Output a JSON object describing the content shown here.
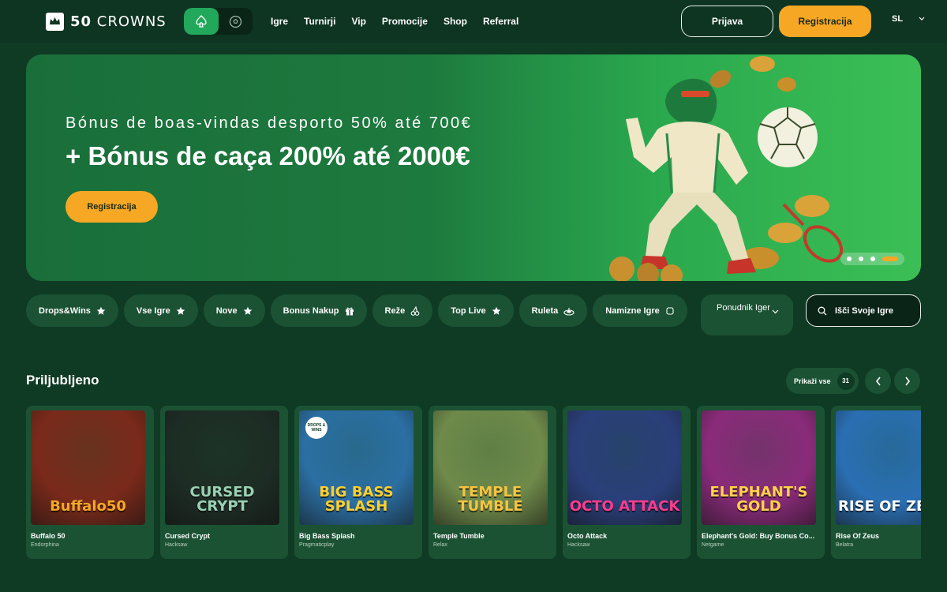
{
  "header": {
    "logo_text_bold": "50",
    "logo_text": "CROWNS",
    "nav": [
      "Igre",
      "Turnirji",
      "Vip",
      "Promocije",
      "Shop",
      "Referral"
    ],
    "login_label": "Prijava",
    "register_label": "Registracija",
    "language": "SL"
  },
  "banner": {
    "subtitle": "Bónus de boas-vindas desporto 50% até 700€",
    "title": "+ Bónus de caça 200% até 2000€",
    "cta_label": "Registracija",
    "slides": 4,
    "active_slide": 4
  },
  "categories": [
    {
      "label": "Drops&Wins",
      "icon": "star-icon"
    },
    {
      "label": "Vse Igre",
      "icon": "star-icon"
    },
    {
      "label": "Nove",
      "icon": "star-icon"
    },
    {
      "label": "Bonus Nakup",
      "icon": "gift-icon"
    },
    {
      "label": "Reže",
      "icon": "cherries-icon"
    },
    {
      "label": "Top Live",
      "icon": "star-icon"
    },
    {
      "label": "Ruleta",
      "icon": "roulette-icon"
    },
    {
      "label": "Namizne Igre",
      "icon": "chip-icon"
    }
  ],
  "provider_filter": {
    "label": "Ponudnik Iger"
  },
  "search": {
    "placeholder": "Išči Svoje Igre"
  },
  "favorites": {
    "title": "Priljubljeno",
    "show_all_label": "Prikaži vse",
    "count": "31",
    "games": [
      {
        "name": "Buffalo 50",
        "provider": "Endorphina",
        "art": "Buffalo50",
        "bg": "#7a2a1a",
        "color": "#f6a724"
      },
      {
        "name": "Cursed Crypt",
        "provider": "Hacksaw",
        "art": "CURSED CRYPT",
        "bg": "#1d2c24",
        "color": "#9bd1b3"
      },
      {
        "name": "Big Bass Splash",
        "provider": "Pragmaticplay",
        "art": "BIG BASS SPLASH",
        "bg": "#2b6fa3",
        "color": "#ffcf2e",
        "badge": "DROPS & WINS"
      },
      {
        "name": "Temple Tumble",
        "provider": "Relax",
        "art": "TEMPLE TUMBLE",
        "bg": "#6f8a4a",
        "color": "#f6c443"
      },
      {
        "name": "Octo Attack",
        "provider": "Hacksaw",
        "art": "OCTO ATTACK",
        "bg": "#2a3f7a",
        "color": "#ff3b8e"
      },
      {
        "name": "Elephant's Gold: Buy Bonus Co...",
        "provider": "Netgame",
        "art": "ELEPHANT'S GOLD",
        "bg": "#8a2b7a",
        "color": "#ffd24a"
      },
      {
        "name": "Rise Of Zeus",
        "provider": "Belatra",
        "art": "RISE OF ZEUS",
        "bg": "#2a6fb3",
        "color": "#ffffff"
      }
    ]
  }
}
